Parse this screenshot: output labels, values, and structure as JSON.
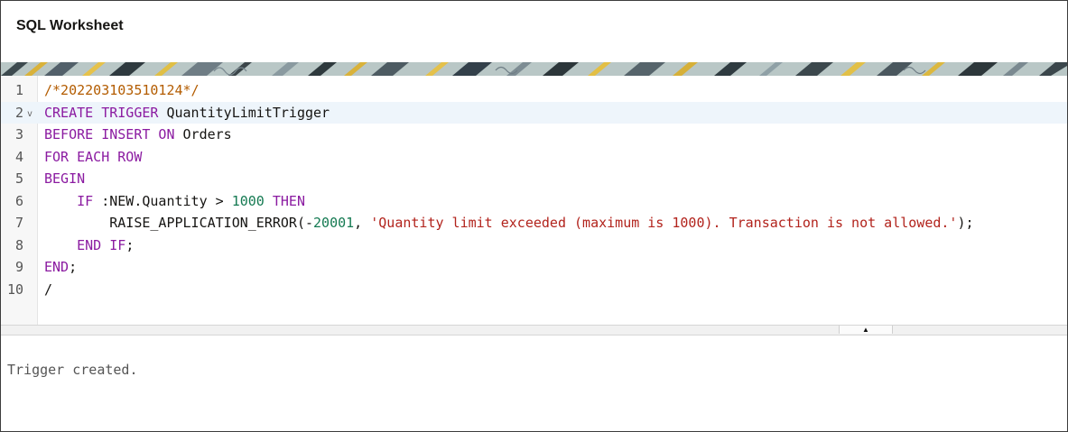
{
  "header": {
    "title": "SQL Worksheet"
  },
  "editor": {
    "active_line": 2,
    "lines": [
      {
        "num": "1",
        "tokens": [
          {
            "t": "c",
            "v": "/*202203103510124*/"
          }
        ]
      },
      {
        "num": "2",
        "fold": "v",
        "tokens": [
          {
            "t": "k",
            "v": "CREATE TRIGGER"
          },
          {
            "t": "p",
            "v": " QuantityLimitTrigger"
          }
        ]
      },
      {
        "num": "3",
        "tokens": [
          {
            "t": "k",
            "v": "BEFORE INSERT ON"
          },
          {
            "t": "p",
            "v": " Orders"
          }
        ]
      },
      {
        "num": "4",
        "tokens": [
          {
            "t": "k",
            "v": "FOR EACH ROW"
          }
        ]
      },
      {
        "num": "5",
        "tokens": [
          {
            "t": "k",
            "v": "BEGIN"
          }
        ]
      },
      {
        "num": "6",
        "tokens": [
          {
            "t": "p",
            "v": "    "
          },
          {
            "t": "k",
            "v": "IF"
          },
          {
            "t": "p",
            "v": " :NEW.Quantity > "
          },
          {
            "t": "n",
            "v": "1000"
          },
          {
            "t": "p",
            "v": " "
          },
          {
            "t": "k",
            "v": "THEN"
          }
        ]
      },
      {
        "num": "7",
        "tokens": [
          {
            "t": "p",
            "v": "        RAISE_APPLICATION_ERROR(-"
          },
          {
            "t": "n",
            "v": "20001"
          },
          {
            "t": "p",
            "v": ", "
          },
          {
            "t": "s",
            "v": "'Quantity limit exceeded (maximum is 1000). Transaction is not allowed.'"
          },
          {
            "t": "p",
            "v": ");"
          }
        ]
      },
      {
        "num": "8",
        "tokens": [
          {
            "t": "p",
            "v": "    "
          },
          {
            "t": "k",
            "v": "END IF"
          },
          {
            "t": "p",
            "v": ";"
          }
        ]
      },
      {
        "num": "9",
        "tokens": [
          {
            "t": "k",
            "v": "END"
          },
          {
            "t": "p",
            "v": ";"
          }
        ]
      },
      {
        "num": "10",
        "tokens": [
          {
            "t": "p",
            "v": "/"
          }
        ]
      }
    ]
  },
  "splitter": {
    "icon": "caret-up-icon",
    "glyph": "▲"
  },
  "output": {
    "text": "Trigger created."
  },
  "colors": {
    "keyword": "#8b1ba1",
    "comment": "#b35c00",
    "number": "#157a52",
    "string": "#b2231c",
    "active_line": "#eef5fb"
  }
}
